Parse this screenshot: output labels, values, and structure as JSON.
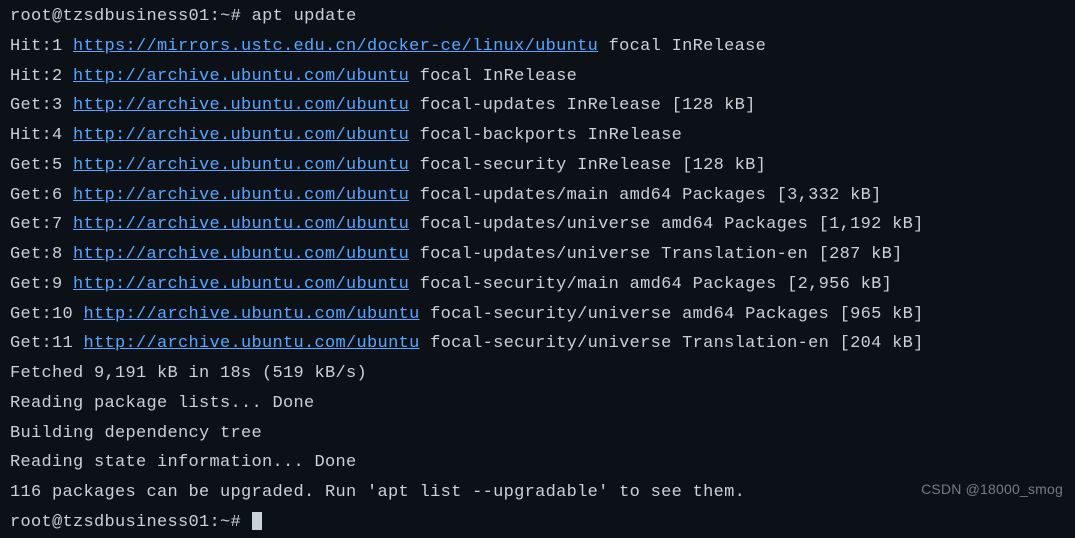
{
  "prompt": {
    "user": "root",
    "host": "tzsdbusiness01",
    "path": "~",
    "symbol": "#",
    "command": "apt update"
  },
  "lines": [
    {
      "prefix": "Hit:1 ",
      "url": "https://mirrors.ustc.edu.cn/docker-ce/linux/ubuntu",
      "suffix": " focal InRelease"
    },
    {
      "prefix": "Hit:2 ",
      "url": "http://archive.ubuntu.com/ubuntu",
      "suffix": " focal InRelease"
    },
    {
      "prefix": "Get:3 ",
      "url": "http://archive.ubuntu.com/ubuntu",
      "suffix": " focal-updates InRelease [128 kB]"
    },
    {
      "prefix": "Hit:4 ",
      "url": "http://archive.ubuntu.com/ubuntu",
      "suffix": " focal-backports InRelease"
    },
    {
      "prefix": "Get:5 ",
      "url": "http://archive.ubuntu.com/ubuntu",
      "suffix": " focal-security InRelease [128 kB]"
    },
    {
      "prefix": "Get:6 ",
      "url": "http://archive.ubuntu.com/ubuntu",
      "suffix": " focal-updates/main amd64 Packages [3,332 kB]"
    },
    {
      "prefix": "Get:7 ",
      "url": "http://archive.ubuntu.com/ubuntu",
      "suffix": " focal-updates/universe amd64 Packages [1,192 kB]"
    },
    {
      "prefix": "Get:8 ",
      "url": "http://archive.ubuntu.com/ubuntu",
      "suffix": " focal-updates/universe Translation-en [287 kB]"
    },
    {
      "prefix": "Get:9 ",
      "url": "http://archive.ubuntu.com/ubuntu",
      "suffix": " focal-security/main amd64 Packages [2,956 kB]"
    },
    {
      "prefix": "Get:10 ",
      "url": "http://archive.ubuntu.com/ubuntu",
      "suffix": " focal-security/universe amd64 Packages [965 kB]"
    },
    {
      "prefix": "Get:11 ",
      "url": "http://archive.ubuntu.com/ubuntu",
      "suffix": " focal-security/universe Translation-en [204 kB]"
    }
  ],
  "status": {
    "fetched": "Fetched 9,191 kB in 18s (519 kB/s)",
    "reading_lists": "Reading package lists... Done",
    "building_tree": "Building dependency tree",
    "reading_state": "Reading state information... Done",
    "upgradable": "116 packages can be upgraded. Run 'apt list --upgradable' to see them."
  },
  "prompt2": {
    "text": "root@tzsdbusiness01:~# "
  },
  "watermark": "CSDN @18000_smog"
}
